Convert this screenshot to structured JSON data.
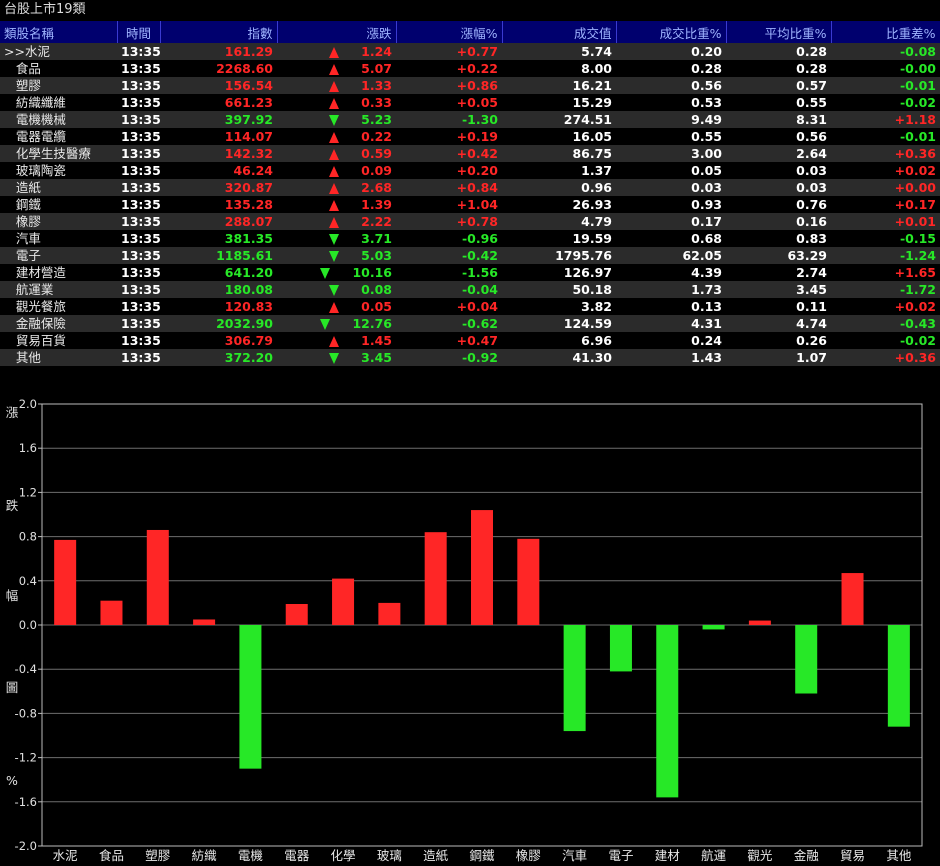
{
  "window": {
    "title": "台股上市19類"
  },
  "table": {
    "headers": [
      "類股名稱",
      "時間",
      "指數",
      "漲跌",
      "漲幅%",
      "成交值",
      "成交比重%",
      "平均比重%",
      "比重差%"
    ],
    "selected_marker": ">>",
    "rows": [
      {
        "name": "水泥",
        "time": "13:35",
        "index": "161.29",
        "dir": "up",
        "change": "1.24",
        "pct": "+0.77",
        "value": "5.74",
        "share": "0.20",
        "avg": "0.28",
        "diff": "-0.08",
        "selected": true
      },
      {
        "name": "食品",
        "time": "13:35",
        "index": "2268.60",
        "dir": "up",
        "change": "5.07",
        "pct": "+0.22",
        "value": "8.00",
        "share": "0.28",
        "avg": "0.28",
        "diff": "-0.00"
      },
      {
        "name": "塑膠",
        "time": "13:35",
        "index": "156.54",
        "dir": "up",
        "change": "1.33",
        "pct": "+0.86",
        "value": "16.21",
        "share": "0.56",
        "avg": "0.57",
        "diff": "-0.01"
      },
      {
        "name": "紡織纖維",
        "time": "13:35",
        "index": "661.23",
        "dir": "up",
        "change": "0.33",
        "pct": "+0.05",
        "value": "15.29",
        "share": "0.53",
        "avg": "0.55",
        "diff": "-0.02"
      },
      {
        "name": "電機機械",
        "time": "13:35",
        "index": "397.92",
        "dir": "down",
        "change": "5.23",
        "pct": "-1.30",
        "value": "274.51",
        "share": "9.49",
        "avg": "8.31",
        "diff": "+1.18"
      },
      {
        "name": "電器電纜",
        "time": "13:35",
        "index": "114.07",
        "dir": "up",
        "change": "0.22",
        "pct": "+0.19",
        "value": "16.05",
        "share": "0.55",
        "avg": "0.56",
        "diff": "-0.01"
      },
      {
        "name": "化學生技醫療",
        "time": "13:35",
        "index": "142.32",
        "dir": "up",
        "change": "0.59",
        "pct": "+0.42",
        "value": "86.75",
        "share": "3.00",
        "avg": "2.64",
        "diff": "+0.36"
      },
      {
        "name": "玻璃陶瓷",
        "time": "13:35",
        "index": "46.24",
        "dir": "up",
        "change": "0.09",
        "pct": "+0.20",
        "value": "1.37",
        "share": "0.05",
        "avg": "0.03",
        "diff": "+0.02"
      },
      {
        "name": "造紙",
        "time": "13:35",
        "index": "320.87",
        "dir": "up",
        "change": "2.68",
        "pct": "+0.84",
        "value": "0.96",
        "share": "0.03",
        "avg": "0.03",
        "diff": "+0.00"
      },
      {
        "name": "鋼鐵",
        "time": "13:35",
        "index": "135.28",
        "dir": "up",
        "change": "1.39",
        "pct": "+1.04",
        "value": "26.93",
        "share": "0.93",
        "avg": "0.76",
        "diff": "+0.17"
      },
      {
        "name": "橡膠",
        "time": "13:35",
        "index": "288.07",
        "dir": "up",
        "change": "2.22",
        "pct": "+0.78",
        "value": "4.79",
        "share": "0.17",
        "avg": "0.16",
        "diff": "+0.01"
      },
      {
        "name": "汽車",
        "time": "13:35",
        "index": "381.35",
        "dir": "down",
        "change": "3.71",
        "pct": "-0.96",
        "value": "19.59",
        "share": "0.68",
        "avg": "0.83",
        "diff": "-0.15"
      },
      {
        "name": "電子",
        "time": "13:35",
        "index": "1185.61",
        "dir": "down",
        "change": "5.03",
        "pct": "-0.42",
        "value": "1795.76",
        "share": "62.05",
        "avg": "63.29",
        "diff": "-1.24"
      },
      {
        "name": "建材營造",
        "time": "13:35",
        "index": "641.20",
        "dir": "down",
        "change": "10.16",
        "pct": "-1.56",
        "value": "126.97",
        "share": "4.39",
        "avg": "2.74",
        "diff": "+1.65"
      },
      {
        "name": "航運業",
        "time": "13:35",
        "index": "180.08",
        "dir": "down",
        "change": "0.08",
        "pct": "-0.04",
        "value": "50.18",
        "share": "1.73",
        "avg": "3.45",
        "diff": "-1.72"
      },
      {
        "name": "觀光餐旅",
        "time": "13:35",
        "index": "120.83",
        "dir": "up",
        "change": "0.05",
        "pct": "+0.04",
        "value": "3.82",
        "share": "0.13",
        "avg": "0.11",
        "diff": "+0.02"
      },
      {
        "name": "金融保險",
        "time": "13:35",
        "index": "2032.90",
        "dir": "down",
        "change": "12.76",
        "pct": "-0.62",
        "value": "124.59",
        "share": "4.31",
        "avg": "4.74",
        "diff": "-0.43"
      },
      {
        "name": "貿易百貨",
        "time": "13:35",
        "index": "306.79",
        "dir": "up",
        "change": "1.45",
        "pct": "+0.47",
        "value": "6.96",
        "share": "0.24",
        "avg": "0.26",
        "diff": "-0.02"
      },
      {
        "name": "其他",
        "time": "13:35",
        "index": "372.20",
        "dir": "down",
        "change": "3.45",
        "pct": "-0.92",
        "value": "41.30",
        "share": "1.43",
        "avg": "1.07",
        "diff": "+0.36"
      }
    ]
  },
  "colors": {
    "up": "#ff2626",
    "down": "#27e827",
    "header_bg": "#00006e",
    "header_text": "#9fb4ff"
  },
  "chart_data": {
    "type": "bar",
    "ylabel_chars": [
      "漲",
      "跌",
      "幅",
      "圖",
      "%"
    ],
    "categories": [
      "水泥",
      "食品",
      "塑膠",
      "紡織",
      "電機",
      "電器",
      "化學",
      "玻璃",
      "造紙",
      "鋼鐵",
      "橡膠",
      "汽車",
      "電子",
      "建材",
      "航運",
      "觀光",
      "金融",
      "貿易",
      "其他"
    ],
    "values": [
      0.77,
      0.22,
      0.86,
      0.05,
      -1.3,
      0.19,
      0.42,
      0.2,
      0.84,
      1.04,
      0.78,
      -0.96,
      -0.42,
      -1.56,
      -0.04,
      0.04,
      -0.62,
      0.47,
      -0.92
    ],
    "yticks": [
      "2.0",
      "1.6",
      "1.2",
      "0.8",
      "0.4",
      "0.0",
      "-0.4",
      "-0.8",
      "-1.2",
      "-1.6",
      "-2.0"
    ],
    "ylim": [
      -2.0,
      2.0
    ],
    "grid": true
  }
}
